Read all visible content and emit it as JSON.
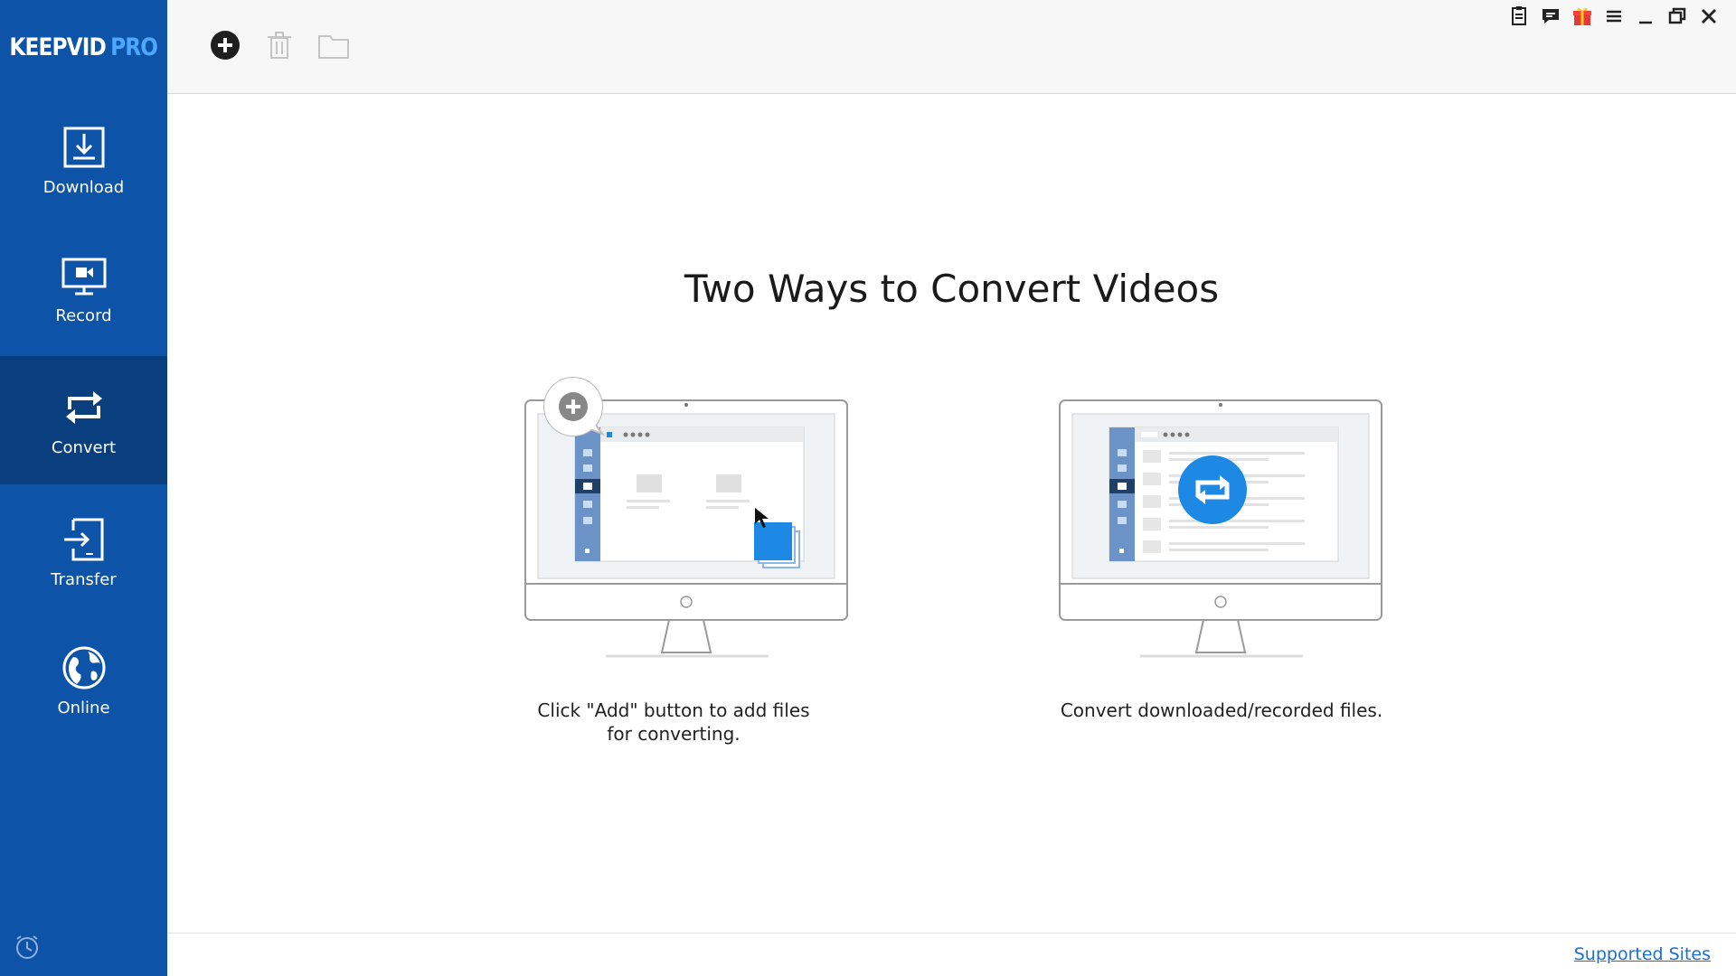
{
  "app": {
    "logo_main": "KEEPVID",
    "logo_accent": "PRO"
  },
  "sidebar": {
    "items": [
      {
        "label": "Download",
        "icon": "download-icon",
        "active": false
      },
      {
        "label": "Record",
        "icon": "record-icon",
        "active": false
      },
      {
        "label": "Convert",
        "icon": "convert-icon",
        "active": true
      },
      {
        "label": "Transfer",
        "icon": "transfer-icon",
        "active": false
      },
      {
        "label": "Online",
        "icon": "online-globe-icon",
        "active": false
      }
    ],
    "footer_icon": "history-clock-icon"
  },
  "toolbar": {
    "buttons": [
      "add-icon",
      "trash-icon",
      "folder-icon"
    ]
  },
  "window_controls": [
    "feedback-icon",
    "chat-icon",
    "gift-icon",
    "menu-icon",
    "minimize-icon",
    "restore-icon",
    "close-icon"
  ],
  "main": {
    "title": "Two Ways to Convert Videos",
    "cards": [
      {
        "caption": "Click \"Add\" button to add files for converting."
      },
      {
        "caption": "Convert downloaded/recorded files."
      }
    ]
  },
  "footer": {
    "supported_sites": "Supported Sites"
  },
  "colors": {
    "sidebar": "#0d53a8",
    "sidebar_active": "#0a3f7f",
    "accent": "#1e88e5",
    "link": "#1a6fd1"
  }
}
